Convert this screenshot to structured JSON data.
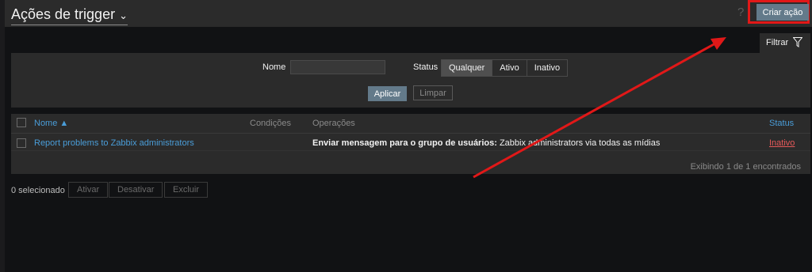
{
  "header": {
    "title": "Ações de trigger",
    "help": "?",
    "create_label": "Criar ação"
  },
  "filter": {
    "tab_label": "Filtrar",
    "name_label": "Nome",
    "name_value": "",
    "status_label": "Status",
    "status_options": [
      "Qualquer",
      "Ativo",
      "Inativo"
    ],
    "status_selected": "Qualquer",
    "apply_label": "Aplicar",
    "clear_label": "Limpar"
  },
  "table": {
    "columns": [
      "Nome ▲",
      "Condições",
      "Operações",
      "Status"
    ],
    "rows": [
      {
        "name": "Report problems to Zabbix administrators",
        "conditions": "",
        "operation_bold": "Enviar mensagem para o grupo de usuários:",
        "operation_rest": " Zabbix administrators via todas as mídias",
        "status": "Inativo"
      }
    ],
    "footer": "Exibindo 1 de 1 encontrados"
  },
  "actions": {
    "selected": "0 selecionado",
    "enable": "Ativar",
    "disable": "Desativar",
    "delete": "Excluir"
  },
  "colors": {
    "accent": "#637a8a",
    "link": "#4a9dd8",
    "inactive": "#e45959",
    "annotation": "#e11818"
  }
}
